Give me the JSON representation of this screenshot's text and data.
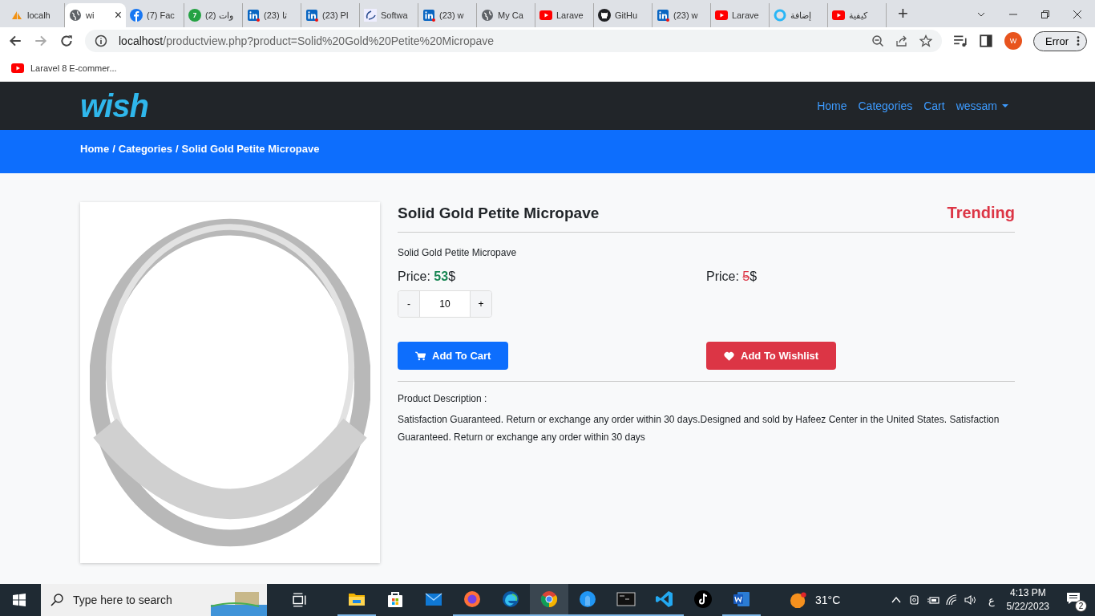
{
  "browser": {
    "tabs": [
      {
        "kind": "pma",
        "label": "localh",
        "selected": false
      },
      {
        "kind": "globe",
        "label": "wi",
        "selected": true,
        "close": "×"
      },
      {
        "kind": "facebook",
        "label": "(7) Fac",
        "selected": false
      },
      {
        "kind": "whatsapp",
        "label": "(2) وات",
        "selected": false
      },
      {
        "kind": "linkedin",
        "label": "(23) تا",
        "selected": false
      },
      {
        "kind": "linkedin",
        "label": "(23) Pl",
        "selected": false
      },
      {
        "kind": "software",
        "label": "Softwa",
        "selected": false
      },
      {
        "kind": "linkedin",
        "label": "(23) w",
        "selected": false
      },
      {
        "kind": "globe",
        "label": "My Ca",
        "selected": false
      },
      {
        "kind": "youtube",
        "label": "Larave",
        "selected": false
      },
      {
        "kind": "github",
        "label": "GitHu",
        "selected": false
      },
      {
        "kind": "linkedin",
        "label": "(23) w",
        "selected": false
      },
      {
        "kind": "youtube",
        "label": "Larave",
        "selected": false
      },
      {
        "kind": "circle",
        "label": "إضافة",
        "selected": false
      },
      {
        "kind": "youtube",
        "label": "كيفية",
        "selected": false
      }
    ],
    "new_tab": "+",
    "address": {
      "host": "localhost",
      "path": "/productview.php?product=Solid%20Gold%20Petite%20Micropave"
    },
    "profile": "W",
    "error_button": "Error",
    "bookmarks": [
      {
        "kind": "youtube",
        "label": "Laravel 8 E-commer..."
      }
    ]
  },
  "navbar": {
    "brand": "wish",
    "links": [
      {
        "label": "Home",
        "dropdown": false
      },
      {
        "label": "Categories",
        "dropdown": false
      },
      {
        "label": "Cart",
        "dropdown": false
      },
      {
        "label": "wessam",
        "dropdown": true
      }
    ]
  },
  "breadcrumb": {
    "items": [
      "Home",
      "Categories",
      "Solid Gold Petite Micropave"
    ],
    "separator": "/"
  },
  "product": {
    "name": "Solid Gold Petite Micropave",
    "badge": "Trending",
    "small_description": "Solid Gold Petite Micropave",
    "selling_price_label": "Price:",
    "original_price_label": "Price:",
    "selling_price": "53",
    "original_price": "5",
    "currency": "$",
    "quantity": {
      "minus": "-",
      "value": "10",
      "plus": "+"
    },
    "add_to_cart": "Add To Cart",
    "add_to_wishlist": "Add To Wishlist",
    "description_label": "Product Description :",
    "description": "Satisfaction Guaranteed. Return or exchange any order within 30 days.Designed and sold by Hafeez Center in the United States. Satisfaction Guaranteed. Return or exchange any order within 30 days"
  },
  "taskbar": {
    "search_placeholder": "Type here to search",
    "apps": [
      {
        "kind": "explorer",
        "running": true,
        "selected": false
      },
      {
        "kind": "store",
        "running": false,
        "selected": false
      },
      {
        "kind": "mail",
        "running": false,
        "selected": false
      },
      {
        "kind": "firefox",
        "running": true,
        "selected": false
      },
      {
        "kind": "edge",
        "running": true,
        "selected": false
      },
      {
        "kind": "chrome",
        "running": true,
        "selected": true
      },
      {
        "kind": "app",
        "running": true,
        "selected": false
      },
      {
        "kind": "terminal",
        "running": true,
        "selected": false
      },
      {
        "kind": "vscode",
        "running": true,
        "selected": false
      },
      {
        "kind": "tiktok",
        "running": false,
        "selected": false
      },
      {
        "kind": "word",
        "running": true,
        "selected": false
      }
    ],
    "weather": "31°C",
    "language": "ع",
    "time": "4:13 PM",
    "date": "5/22/2023",
    "notifications": "2"
  }
}
